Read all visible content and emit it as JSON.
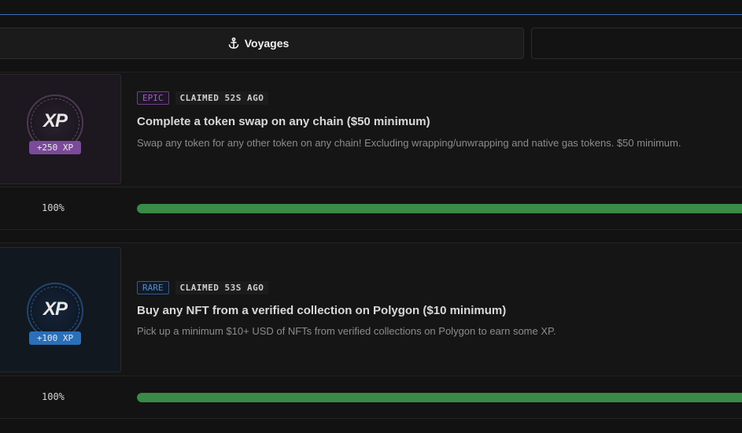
{
  "tabs": [
    {
      "label": "Voyages",
      "icon": "anchor-icon",
      "active": true
    },
    {
      "label": "",
      "active": false
    }
  ],
  "quests": [
    {
      "rarity": "EPIC",
      "rarity_color": "#a05fc2",
      "claimed": "CLAIMED 52S AGO",
      "title": "Complete a token swap on any chain ($50 minimum)",
      "description": "Swap any token for any other token on any chain! Excluding wrapping/unwrapping and native gas tokens. $50 minimum.",
      "badge_text": "XP",
      "xp_reward": "+250 XP",
      "progress_label": "100%",
      "progress": 1.0
    },
    {
      "rarity": "RARE",
      "rarity_color": "#4c8ed6",
      "claimed": "CLAIMED 53S AGO",
      "title": "Buy any NFT from a verified collection on Polygon ($10 minimum)",
      "description": "Pick up a minimum $10+ USD of NFTs from verified collections on Polygon to earn some XP.",
      "badge_text": "XP",
      "xp_reward": "+100 XP",
      "progress_label": "100%",
      "progress": 1.0
    }
  ],
  "colors": {
    "accent_line": "#3f6fb8",
    "progress_fill": "#3a8a48"
  }
}
